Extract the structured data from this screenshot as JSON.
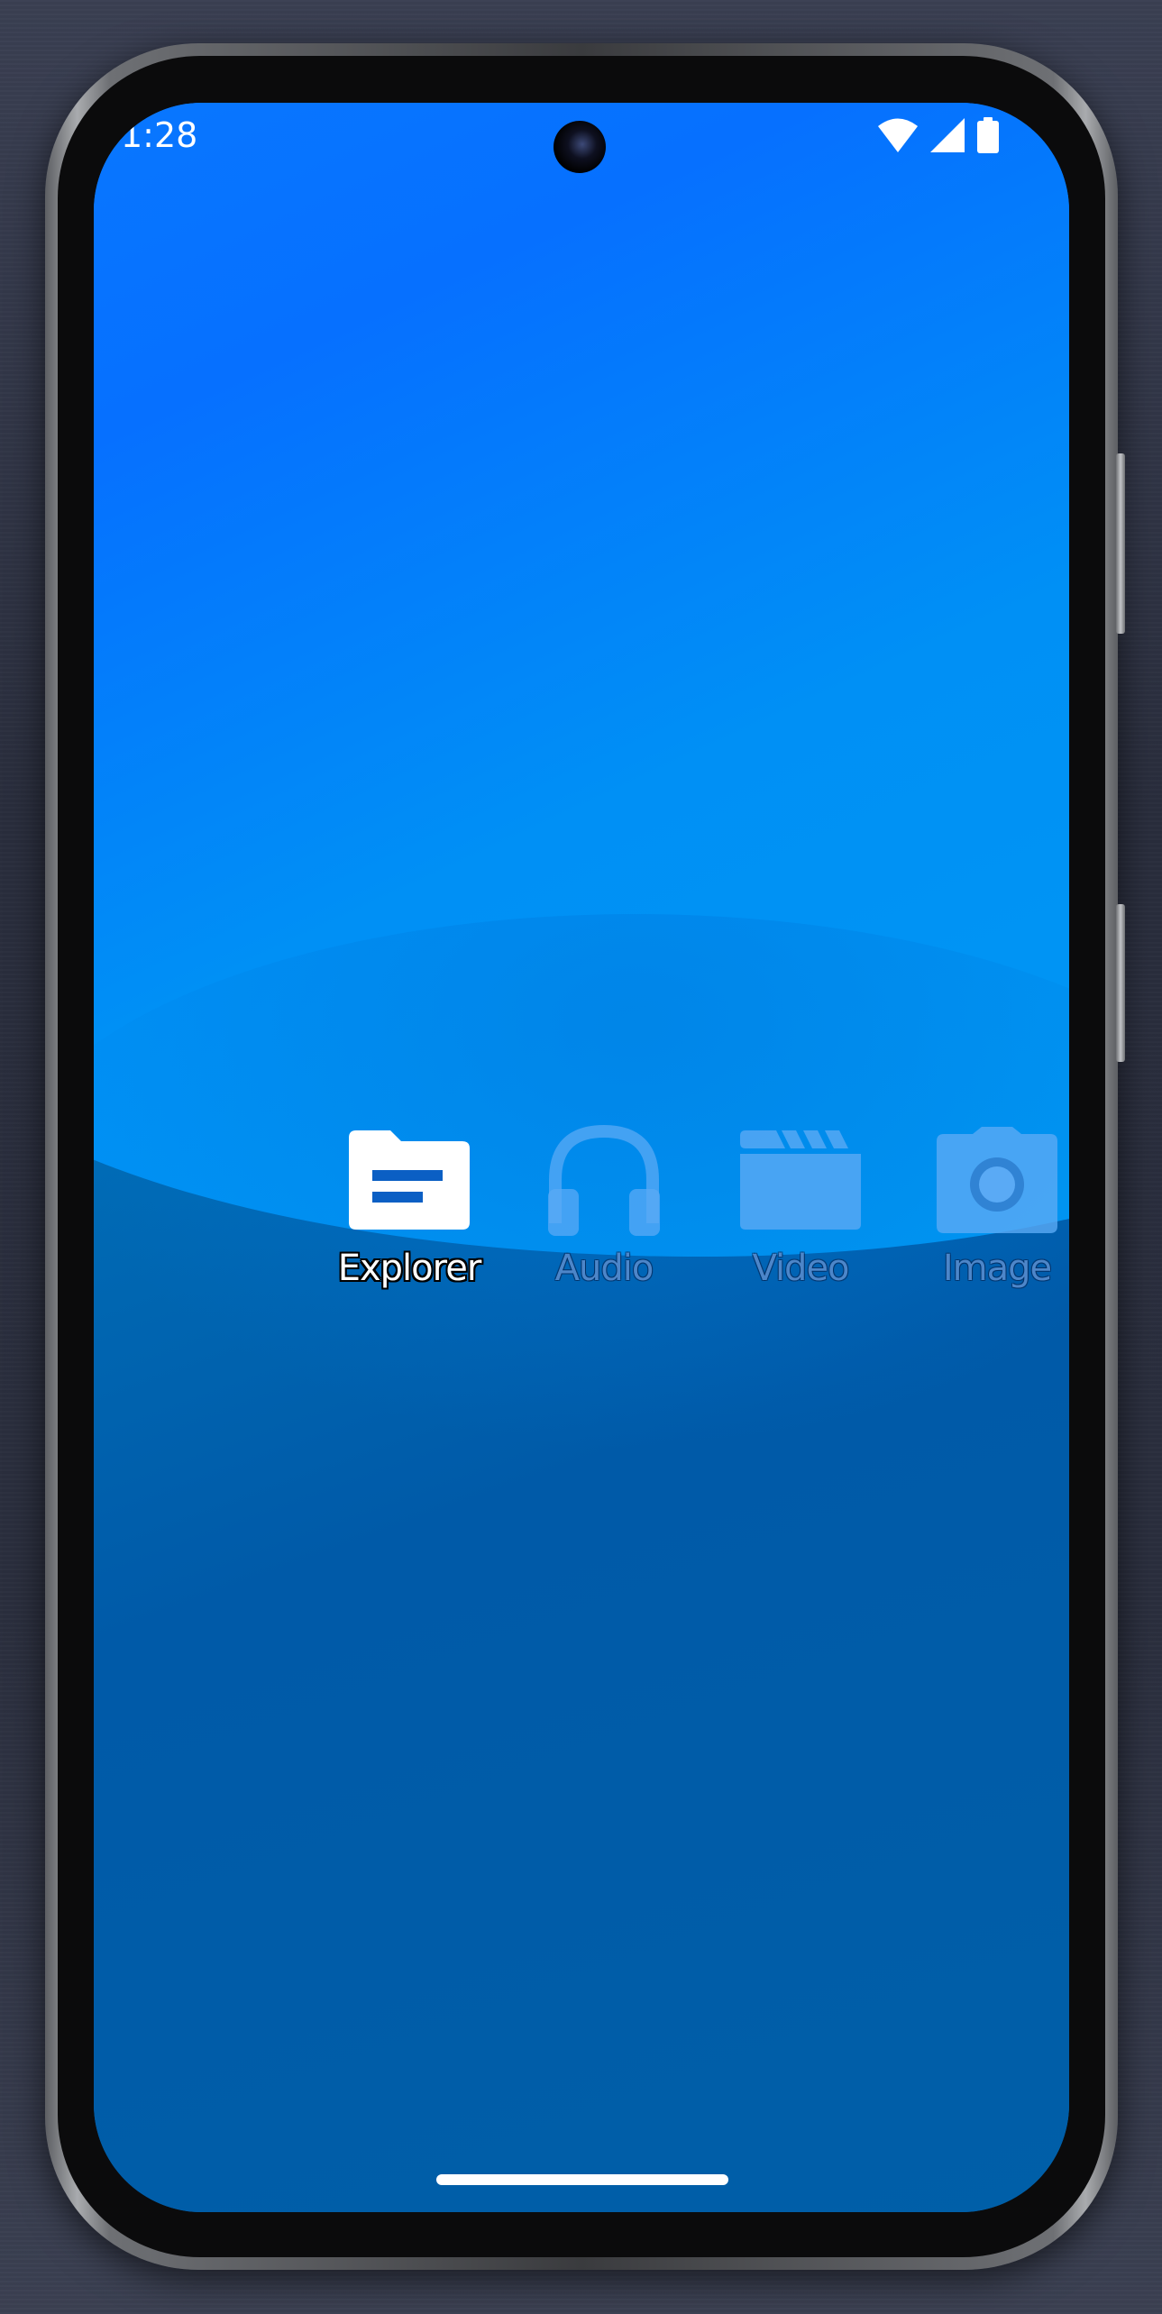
{
  "status_bar": {
    "time": "1:28",
    "icons": [
      "wifi-icon",
      "signal-icon",
      "battery-icon"
    ]
  },
  "apps": [
    {
      "label": "Explorer",
      "icon": "folder-icon",
      "state": "selected"
    },
    {
      "label": "Audio",
      "icon": "headphones-icon",
      "state": "dimmed"
    },
    {
      "label": "Video",
      "icon": "clapperboard-icon",
      "state": "dimmed"
    },
    {
      "label": "Image",
      "icon": "camera-icon",
      "state": "dimmed"
    }
  ],
  "colors": {
    "background_top": "#0072ff",
    "background_bottom": "#005fa8",
    "active_icon": "#ffffff",
    "dim_icon": "#5aaaf5"
  }
}
